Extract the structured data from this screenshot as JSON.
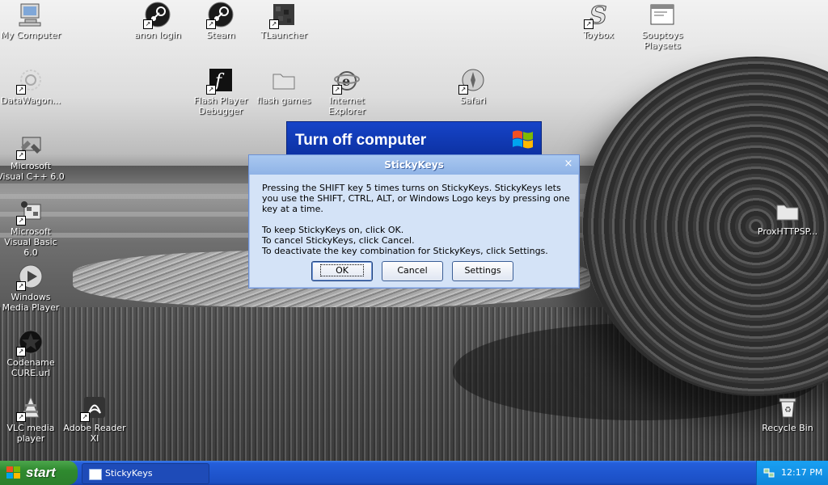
{
  "desktop": {
    "icons": [
      {
        "label": "My Computer"
      },
      {
        "label": "anon login"
      },
      {
        "label": "Steam"
      },
      {
        "label": "TLauncher"
      },
      {
        "label": "Toybox"
      },
      {
        "label": "Souptoys Playsets"
      },
      {
        "label": "DataWagon..."
      },
      {
        "label": "Flash Player Debugger"
      },
      {
        "label": "flash games"
      },
      {
        "label": "Internet Explorer"
      },
      {
        "label": "Safari"
      },
      {
        "label": "Microsoft Visual C++ 6.0"
      },
      {
        "label": "Microsoft Visual Basic 6.0"
      },
      {
        "label": "ProxHTTPSP..."
      },
      {
        "label": "Windows Media Player"
      },
      {
        "label": "Codename CURE.url"
      },
      {
        "label": "VLC media player"
      },
      {
        "label": "Adobe Reader XI"
      },
      {
        "label": "Recycle Bin"
      }
    ]
  },
  "turnoff": {
    "title": "Turn off computer"
  },
  "dialog": {
    "title": "StickyKeys",
    "para1": "Pressing the SHIFT key 5 times turns on StickyKeys. StickyKeys lets you use the SHIFT, CTRL, ALT, or Windows Logo keys by pressing one key at a time.",
    "line1": "To keep StickyKeys on, click OK.",
    "line2": "To cancel StickyKeys, click Cancel.",
    "line3": "To deactivate the key combination for StickyKeys, click Settings.",
    "ok": "OK",
    "cancel": "Cancel",
    "settings": "Settings",
    "close_glyph": "×"
  },
  "taskbar": {
    "start": "start",
    "task_label": "StickyKeys",
    "clock": "12:17 PM"
  },
  "colors": {
    "taskbar_blue": "#245edb",
    "start_green": "#2f8a2f",
    "tray_blue": "#0f86db",
    "dialog_bg": "#d4e3f7"
  }
}
